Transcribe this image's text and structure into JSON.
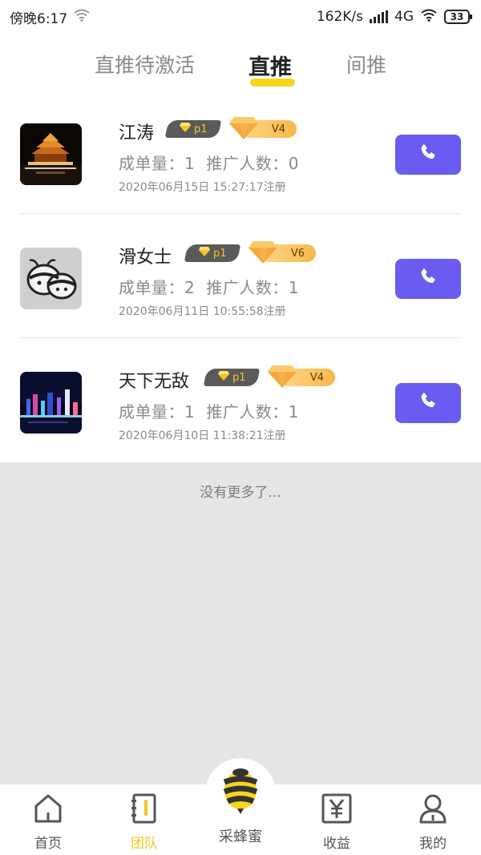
{
  "status_bar": {
    "time": "傍晚6:17",
    "net_speed": "162K/s",
    "network": "4G",
    "battery": "33"
  },
  "tabs": [
    {
      "label": "直推待激活"
    },
    {
      "label": "直推"
    },
    {
      "label": "间推"
    }
  ],
  "members": [
    {
      "name": "江涛",
      "p_level": "p1",
      "v_level": "V4",
      "stats": {
        "orders_label": "成单量：",
        "orders": "1",
        "referrals_label": "推广人数：",
        "referrals": "0"
      },
      "registered": "2020年06月15日 15:27:17注册"
    },
    {
      "name": "滑女士",
      "p_level": "p1",
      "v_level": "V6",
      "stats": {
        "orders_label": "成单量：",
        "orders": "2",
        "referrals_label": "推广人数：",
        "referrals": "1"
      },
      "registered": "2020年06月11日 10:55:58注册"
    },
    {
      "name": "天下无敌",
      "p_level": "p1",
      "v_level": "V4",
      "stats": {
        "orders_label": "成单量：",
        "orders": "1",
        "referrals_label": "推广人数：",
        "referrals": "1"
      },
      "registered": "2020年06月10日 11:38:21注册"
    }
  ],
  "no_more_text": "没有更多了...",
  "bottom_nav": [
    {
      "label": "首页",
      "icon": "home-icon"
    },
    {
      "label": "团队",
      "icon": "team-book-icon"
    },
    {
      "label": "采蜂蜜",
      "icon": "bee-icon"
    },
    {
      "label": "收益",
      "icon": "yuan-icon"
    },
    {
      "label": "我的",
      "icon": "user-icon"
    }
  ],
  "colors": {
    "accent_yellow": "#f8d51d",
    "call_button": "#6a5cf0",
    "page_bg": "#e5e5e5"
  }
}
